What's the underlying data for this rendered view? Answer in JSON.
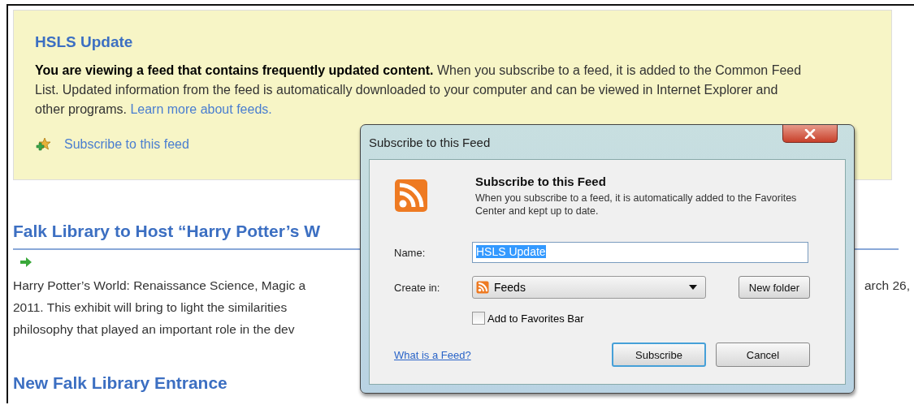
{
  "feed_banner": {
    "title": "HSLS Update",
    "description": "**You are viewing a feed that contains frequently updated content.** When you subscribe to a feed, it is added to the Common Feed List. Updated information from the feed is automatically downloaded to your computer and can be viewed in Internet Explorer and other programs.",
    "learn_more_link": "Learn more about feeds.",
    "subscribe_link": "Subscribe to this feed"
  },
  "articles": [
    {
      "title": "Falk Library to Host “Harry Potter’s W",
      "lines": [
        "Harry Potter’s World: Renaissance Science, Magic a",
        "2011. This exhibit will bring to light the similarities",
        "philosophy that played an important role in the dev"
      ],
      "right_fragment": "arch 26,"
    },
    {
      "title": "New Falk Library Entrance"
    }
  ],
  "dialog": {
    "title": "Subscribe to this Feed",
    "heading": "Subscribe to this Feed",
    "description": "When you subscribe to a feed, it is automatically added to the Favorites Center and kept up to date.",
    "name_label": "Name:",
    "name_value": "HSLS Update",
    "name_text_selected": true,
    "create_in_label": "Create in:",
    "create_in_value": "Feeds",
    "new_folder_button": "New folder",
    "add_to_favorites": {
      "label": "Add to Favorites Bar",
      "checked": false
    },
    "help_link": "What is a Feed?",
    "buttons": [
      {
        "label": "Subscribe",
        "default": true
      },
      {
        "label": "Cancel",
        "default": false
      }
    ]
  }
}
